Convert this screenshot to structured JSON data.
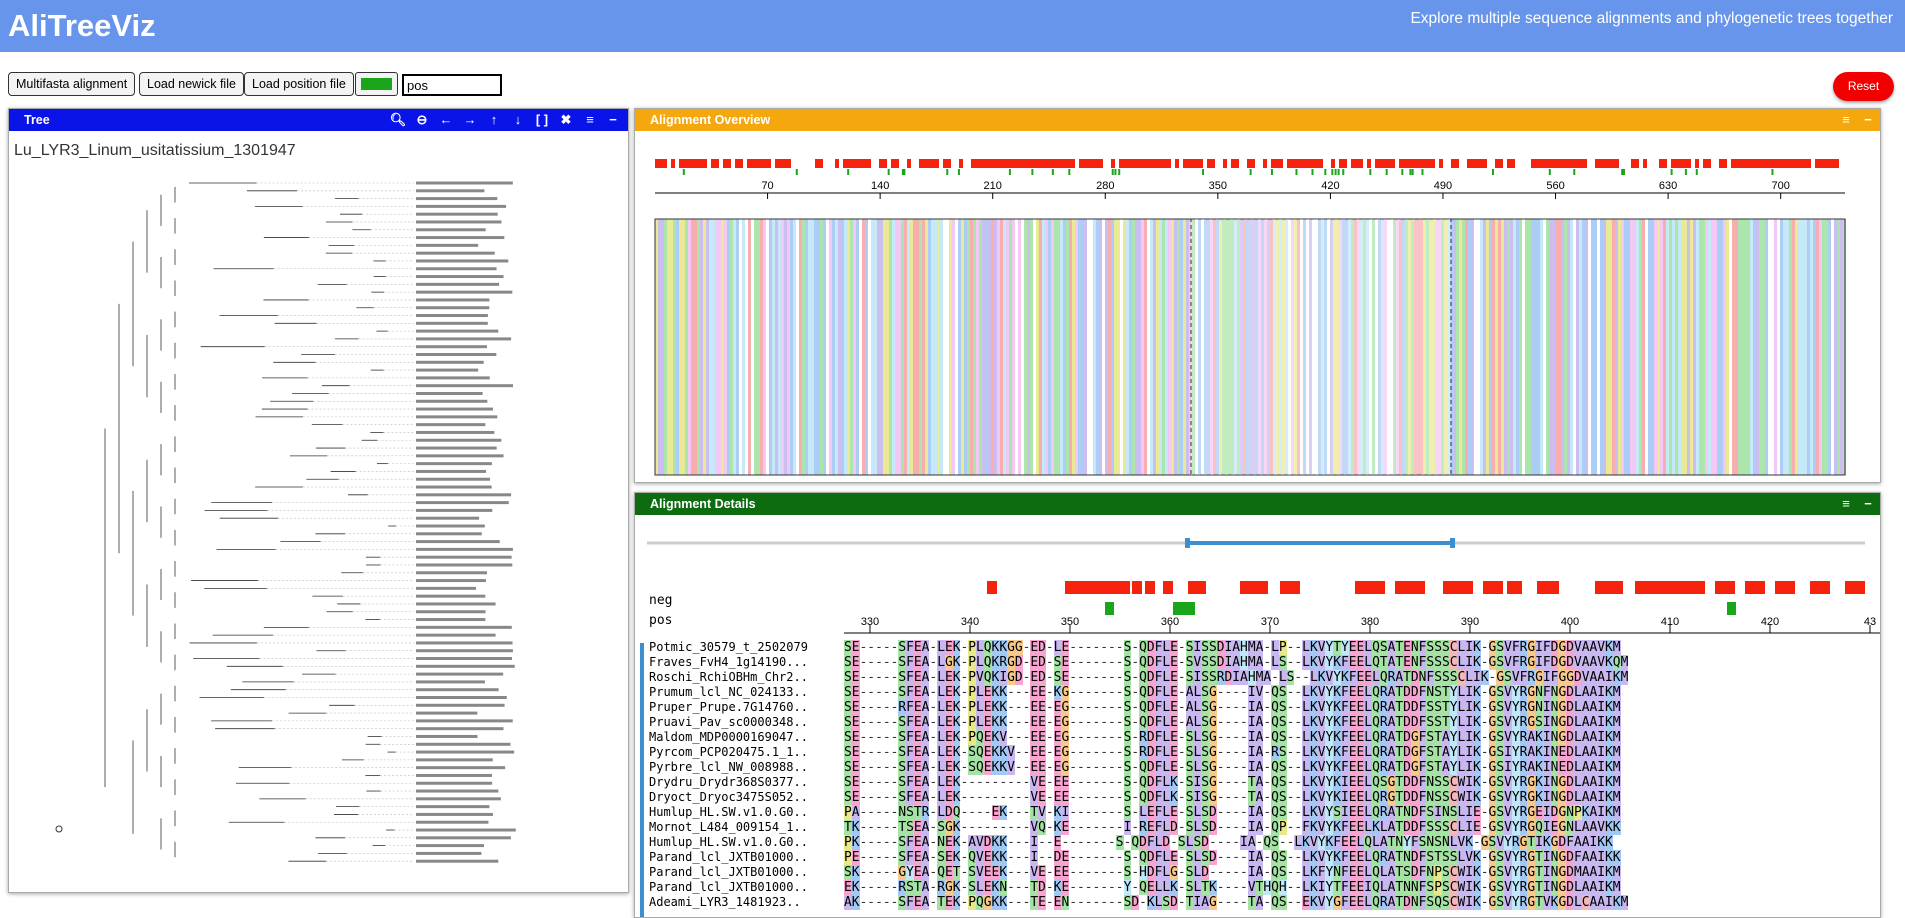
{
  "header": {
    "title": "AliTreeViz",
    "tagline": "Explore multiple sequence alignments and phylogenetic trees together"
  },
  "toolbar": {
    "multifasta_label": "Multifasta alignment",
    "newick_label": "Load newick file",
    "position_label": "Load position file",
    "color_value": "#1aa51a",
    "position_input_value": "pos",
    "reset_label": "Reset"
  },
  "tree_panel": {
    "title": "Tree",
    "root_label": "Lu_LYR3_Linum_usitatissium_1301947",
    "tools": [
      "zoom-in-icon",
      "zoom-out-icon",
      "arrow-left-icon",
      "arrow-right-icon",
      "arrow-up-icon",
      "arrow-down-icon",
      "fit-icon",
      "shuffle-icon",
      "menu-icon",
      "minimize-icon"
    ]
  },
  "overview_panel": {
    "title": "Alignment Overview",
    "axis_ticks": [
      "70",
      "140",
      "210",
      "280",
      "350",
      "420",
      "490",
      "560",
      "630",
      "700"
    ]
  },
  "details_panel": {
    "title": "Alignment Details",
    "track_neg": "neg",
    "track_pos": "pos",
    "axis_ticks": [
      "330",
      "340",
      "350",
      "360",
      "370",
      "380",
      "390",
      "400",
      "410",
      "420",
      "43"
    ],
    "sequences": [
      {
        "name": "Potmic_30579_t_2502079",
        "seq": "SE-----SFEA-LEK-PLQKKGG-ED-LE-------S-QDFLE-SISSDIAHMA-LP--LKVYTYEELQSATENFSSSCLIK-GSVFRGIFDGDVAAVKM"
      },
      {
        "name": "Fraves_FvH4_1g14190...",
        "seq": "SE-----SFEA-LGK-PLQKRGD-ED-SE-------S-QDFLE-SVSSDIAHMA-LS--LKVYKFEELQTATENFSSSCLIK-GSVFRGIFDGDVAAVKQM"
      },
      {
        "name": "Roschi_RchiOBHm_Chr2..",
        "seq": "SE-----SFEA-LEK-PVQKIGD-ED-SE-------S-QDFLE-SISSRDIAHMA-LS--LKVYKFEELQRATDNFSSSCLIK-GSVFRGIFGGDVAAIKM"
      },
      {
        "name": "Prumum_lcl_NC_024133..",
        "seq": "SE-----SFEA-LEK-PLEKK---EE-KG-------S-QDFLE-ALSG----IV-QS--LKVYKFEELQRATDDFNSTYLIK-GSVYRGNFNGDLAAIKM"
      },
      {
        "name": "Pruper_Prupe.7G14760..",
        "seq": "SE-----RFEA-LEK-PLEKK---EE-EG-------S-QDFLE-ALSG----IA-QS--LKVYKFEELQRATDDFSSTYLIK-GSVYRGNINGDLAAIKM"
      },
      {
        "name": "Pruavi_Pav_sc0000348..",
        "seq": "SE-----SFEA-LEK-PLEKK---EE-EG-------S-QDFLE-ALSG----IA-QS--LKVYKFEELQRATDDFSSTYLIK-GSVYRGSINGDLAAIKM"
      },
      {
        "name": "Maldom_MDP0000169047..",
        "seq": "SE-----SFEA-LEK-PQEKV---EE-EG-------S-RDFLE-SLSG----IA-QS--LKVYKFEELQRATDGFSTAYLIK-GSVYRAKINGDLAAIKM"
      },
      {
        "name": "Pyrcom_PCP020475.1_1..",
        "seq": "SE-----SFEA-LEK-SQEKKV--EE-EG-------S-RDFLE-SLSG----IA-RS--LKVYKFEELQRATDGFSTAYLIK-GSIYRAKINEDLAAIKM"
      },
      {
        "name": "Pyrbre_lcl_NW_008988..",
        "seq": "SE-----SFEA-LEK-SQEKKV--EE-EG-------S-QDFLE-SLSG----IA-QS--LKVYKFEELQRATDGFSTAYLIK-GSIYRAKINEDLAAIKM"
      },
      {
        "name": "Drydru_Drydr368S0377..",
        "seq": "SE-----SFEA-LEK---------VE-EE-------S-QDFLK-SISG----TA-QS--LKVYKIEELQSGTDDFNSSCWIK-GSVYRGKINGDLAAIKM"
      },
      {
        "name": "Dryoct_Dryoc3475S052..",
        "seq": "SE-----SFEA-LEK---------VE-EE-------S-QDFLK-SISG----TA-QS--LKVYKIEELQRGTDDFNSSCWIK-GSVYRGKINGDLAAIKM"
      },
      {
        "name": "Humlup_HL.SW.v1.0.G0..",
        "seq": "PA-----NSTR-LDQ----EK---TV-KI-------S-LEFLE-SLSD----IA-QS--LKVYSIEELQRATNDFSINSLIE-GSVYRGEIDGNPKAIKM"
      },
      {
        "name": "Mornot_L484_009154_1..",
        "seq": "TK-----TSEA-SGK---------VQ-KE-------I-REFLD-SLSD----IA-QP--FKVYKFEELKLATDDFSSSCLIE-GSVYRGQIEGNLAAVKK"
      },
      {
        "name": "Humlup_HL.SW.v1.0.G0..",
        "seq": "PK-----SFEA-NEK-AVDKK---I--E-------S-QDFLD-SLSD----IA-QS--LKVYKFEELQLATNYFSNSNLVK-GSVYRGTIKGDFAAIKK"
      },
      {
        "name": "Parand_lcl_JXTB01000..",
        "seq": "PE-----SFEA-SEK-QVEKK---I--DE-------S-QDFLE-SLSD----IA-QS--LKVYKFEELQRATNDFSTSSLVK-GSVYRGTINGDFAAIKK"
      },
      {
        "name": "Parand_lcl_JXTB01000..",
        "seq": "SK-----GYEA-QET-SVEEK---VE-EE-------S-HDFLG-SLD-----IA-QS--LKFYNFEELQLATSDFNPSCWIK-GSVYRGTINGDMAAIKM"
      },
      {
        "name": "Parand_lcl_JXTB01000..",
        "seq": "EK-----RSTA-RGK-SLEKN---TD-KE-------Y-QELLK-SLTK----VTHQH--LKIYTFEEIQLATNNFSPSCWIK-GSVYRGTINGDLAAIKM"
      },
      {
        "name": "Adeami_LYR3_1481923..",
        "seq": "AK-----SFEA-TEK-PQGKK---TE-EN-------SD-KLSD-TIAG----TA-QS--EKVYGFEELQRATDNFSQSCWIK-GSVYRGTVKGDLCAAIKM"
      }
    ]
  }
}
